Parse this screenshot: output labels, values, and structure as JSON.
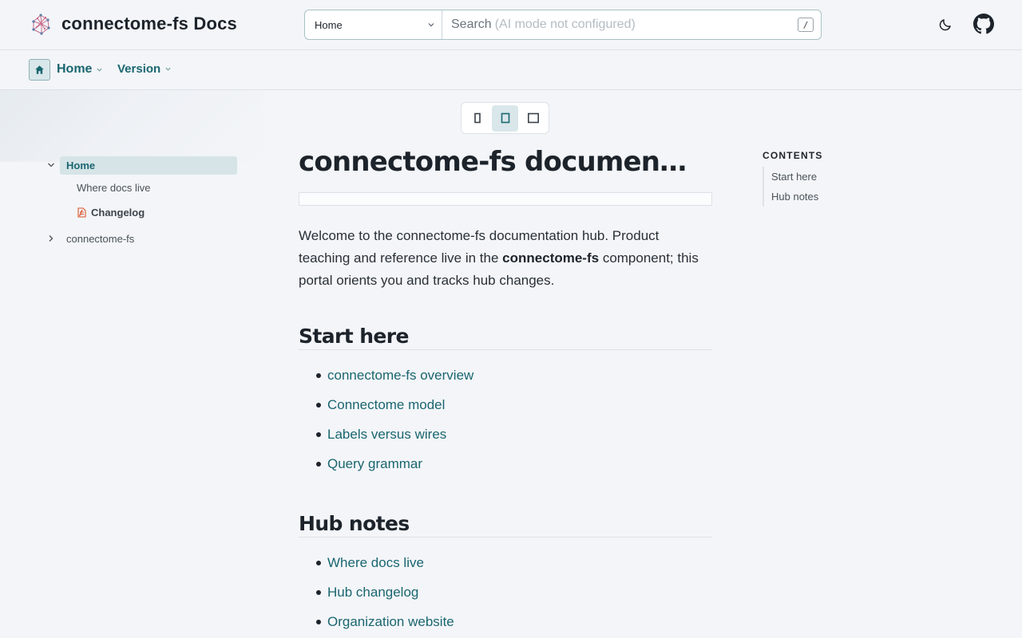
{
  "header": {
    "site_title": "connectome-fs Docs",
    "search": {
      "scope_value": "Home",
      "label": "Search",
      "hint": "(AI mode not configured)",
      "shortcut": "/"
    },
    "icons": {
      "logo": "network-graph-logo",
      "theme": "moon-icon",
      "github": "github-icon"
    }
  },
  "subnav": {
    "home_label": "Home",
    "version_label": "Version"
  },
  "width_toggle": {
    "options": [
      "narrow",
      "medium",
      "wide"
    ],
    "active": "medium"
  },
  "sidebar": {
    "home": "Home",
    "children": [
      "Where docs live",
      "Changelog"
    ],
    "repo": "connectome-fs"
  },
  "article": {
    "title": "connectome-fs documentati…",
    "intro_before": "Welcome to the connectome-fs documentation hub. Product teaching and reference live in the ",
    "intro_strong": "connectome-fs",
    "intro_after": " component; this portal orients you and tracks hub changes.",
    "sections": [
      {
        "heading": "Start here",
        "links": [
          "connectome-fs overview",
          "Connectome model",
          "Labels versus wires",
          "Query grammar"
        ]
      },
      {
        "heading": "Hub notes",
        "links": [
          "Where docs live",
          "Hub changelog",
          "Organization website"
        ]
      }
    ]
  },
  "toc": {
    "title": "CONTENTS",
    "items": [
      "Start here",
      "Hub notes"
    ]
  },
  "colors": {
    "accent": "#1a6670",
    "accent_soft": "#d6e4e7",
    "background": "#f3f5f8",
    "text": "#1d232b",
    "changelog_icon": "#d9542b"
  }
}
